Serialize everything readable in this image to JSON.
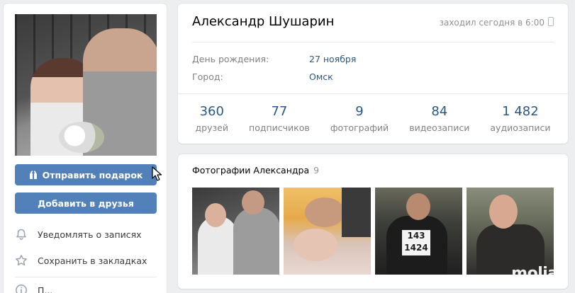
{
  "left": {
    "send_gift_label": "Отправить подарок",
    "add_friend_label": "Добавить в друзья",
    "menu": [
      {
        "label": "Уведомлять о записях",
        "icon": "bell-icon"
      },
      {
        "label": "Сохранить в закладках",
        "icon": "star-icon"
      },
      {
        "label": "П...",
        "icon": "info-icon"
      }
    ]
  },
  "profile": {
    "name": "Александр Шушарин",
    "last_seen": "заходил сегодня в 6:00",
    "info": [
      {
        "label": "День рождения:",
        "value": "27 ноября"
      },
      {
        "label": "Город:",
        "value": "Омск"
      }
    ],
    "counters": [
      {
        "num": "360",
        "label": "друзей"
      },
      {
        "num": "77",
        "label": "подписчиков"
      },
      {
        "num": "9",
        "label": "фотографий"
      },
      {
        "num": "84",
        "label": "видеозаписи"
      },
      {
        "num": "1 482",
        "label": "аудиозаписи"
      }
    ]
  },
  "photos": {
    "title": "Фотографии Александра",
    "count": "9",
    "bib_number": "143\n1424"
  },
  "watermark": "moljar",
  "colors": {
    "accent": "#5181b8",
    "link": "#2a5885",
    "background": "#edeef0",
    "muted": "#828282"
  }
}
